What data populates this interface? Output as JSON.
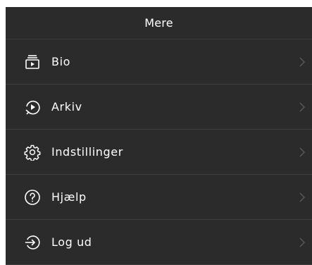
{
  "header": {
    "title": "Mere"
  },
  "menu": {
    "items": [
      {
        "label": "Bio",
        "icon": "cinema-icon"
      },
      {
        "label": "Arkiv",
        "icon": "archive-icon"
      },
      {
        "label": "Indstillinger",
        "icon": "gear-icon"
      },
      {
        "label": "Hjælp",
        "icon": "help-icon"
      },
      {
        "label": "Log ud",
        "icon": "logout-icon"
      }
    ]
  },
  "colors": {
    "panel_background": "#2b2b2b",
    "divider": "#3f3f3f",
    "text": "#ffffff",
    "chevron": "#5c5c5c"
  }
}
